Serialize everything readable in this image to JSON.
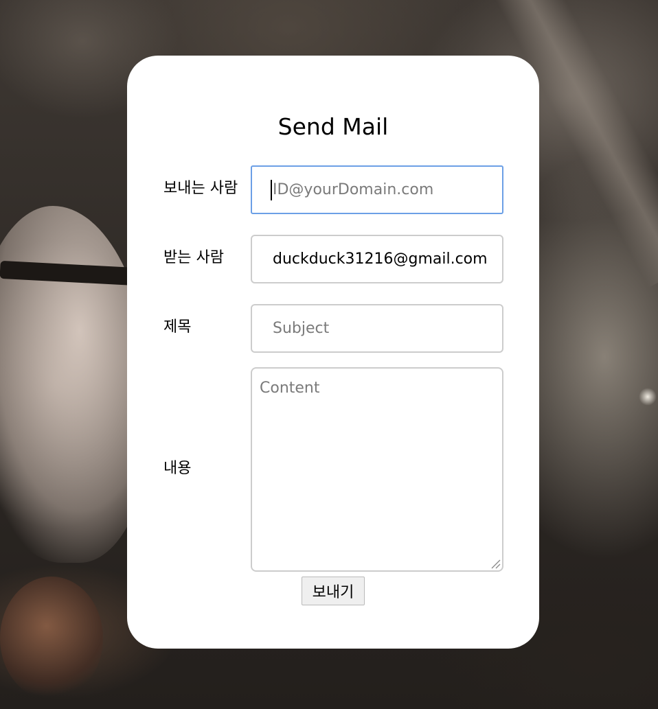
{
  "form": {
    "title": "Send Mail",
    "from": {
      "label": "보내는 사람",
      "value": "",
      "placeholder": "ID@yourDomain.com"
    },
    "to": {
      "label": "받는 사람",
      "value": "duckduck31216@gmail.com",
      "placeholder": ""
    },
    "subject": {
      "label": "제목",
      "value": "",
      "placeholder": "Subject"
    },
    "content": {
      "label": "내용",
      "value": "",
      "placeholder": "Content"
    },
    "submit_label": "보내기"
  },
  "colors": {
    "card_background": "#ffffff",
    "focus_border": "#6b9fe6",
    "field_border": "#cccccc",
    "placeholder": "#7a7a7a"
  },
  "icons": {
    "resize_handle": "resize-grip-icon"
  }
}
